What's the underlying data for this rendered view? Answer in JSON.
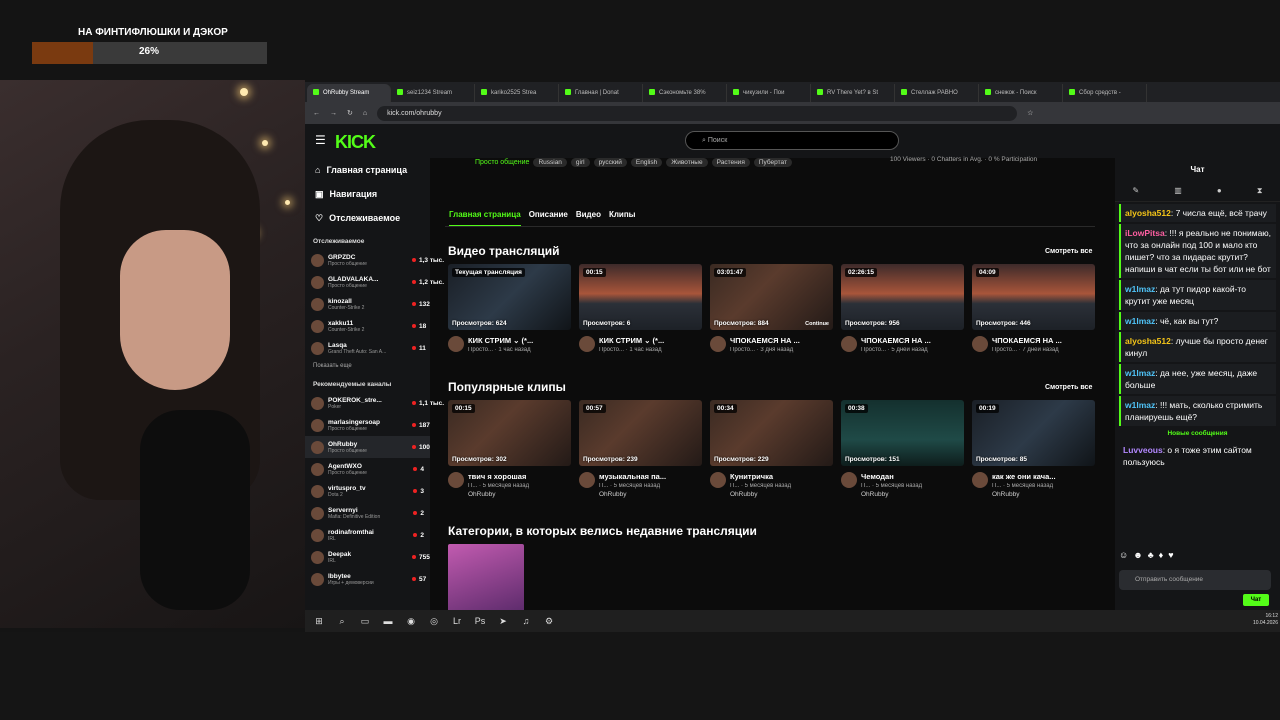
{
  "goal": {
    "title": "НА ФИНТИФЛЮШКИ И ДЭКОР",
    "percent": "26%",
    "progress": 0.26
  },
  "browser": {
    "tabs": [
      "OhRubby Stream",
      "seiz1234 Stream",
      "kariko2525 Strea",
      "Главная | Donat",
      "Сэкономьте 38%",
      "чикузили - Пои",
      "RV There Yet? в St",
      "Стеллаж РАВНО",
      "снежок - Поиск",
      "Сбор средств - "
    ],
    "url": "kick.com/ohrubby"
  },
  "kick": {
    "logo": "KICK",
    "search_placeholder": "Поиск",
    "nav": [
      "Главная страница",
      "Навигация",
      "Отслеживаемое"
    ],
    "following_title": "Отслеживаемое",
    "following": [
      {
        "name": "GRPZDC",
        "sub": "Просто общение",
        "viewers": "1,3 тыс."
      },
      {
        "name": "GLADVALAKA...",
        "sub": "Просто общение",
        "viewers": "1,2 тыс."
      },
      {
        "name": "kinozall",
        "sub": "Counter-Strike 2",
        "viewers": "132"
      },
      {
        "name": "xakku11",
        "sub": "Counter-Strike 2",
        "viewers": "18"
      },
      {
        "name": "Lasqa",
        "sub": "Grand Theft Auto: San A...",
        "viewers": "11"
      }
    ],
    "show_more": "Показать еще",
    "recommended_title": "Рекомендуемые каналы",
    "recommended": [
      {
        "name": "POKEROK_stre...",
        "sub": "Poker",
        "viewers": "1,1 тыс."
      },
      {
        "name": "marlasingersoap",
        "sub": "Просто общение",
        "viewers": "187"
      },
      {
        "name": "OhRubby",
        "sub": "Просто общение",
        "viewers": "100"
      },
      {
        "name": "AgentWXO",
        "sub": "Просто общение",
        "viewers": "4"
      },
      {
        "name": "virtuspro_tv",
        "sub": "Dota 2",
        "viewers": "3"
      },
      {
        "name": "Servernyi",
        "sub": "Mafia: Definitive Edition",
        "viewers": "2"
      },
      {
        "name": "rodinafromthai",
        "sub": "IRL",
        "viewers": "2"
      },
      {
        "name": "Deepak",
        "sub": "IRL",
        "viewers": "755"
      },
      {
        "name": "lbbytee",
        "sub": "Игры + демоверсии",
        "viewers": "57"
      }
    ],
    "category": "Просто общение",
    "tags": [
      "Russian",
      "girl",
      "русский",
      "English",
      "Животные",
      "Растения",
      "Пубертат"
    ],
    "stats": "100 Viewers · 0 Chatters in Avg. · 0 % Participation",
    "page_tabs": [
      "Главная страница",
      "Описание",
      "Видео",
      "Клипы"
    ],
    "videos_title": "Видео трансляций",
    "see_all": "Смотреть все",
    "videos": [
      {
        "label": "Текущая трансляция",
        "views": "Просмотров: 624",
        "title": "КИК СТРИМ ⌄ (*...",
        "sub": "Просто... · 1 час назад",
        "style": "screen",
        "cont": ""
      },
      {
        "label": "00:15",
        "views": "Просмотров: 6",
        "title": "КИК СТРИМ ⌄ (*...",
        "sub": "Просто... · 1 час назад",
        "style": "sunset",
        "cont": ""
      },
      {
        "label": "03:01:47",
        "views": "Просмотров: 884",
        "title": "ЧПОКАЕМСЯ НА ...",
        "sub": "Просто... · 3 дня назад",
        "style": "room",
        "cont": "Continue"
      },
      {
        "label": "02:26:15",
        "views": "Просмотров: 956",
        "title": "ЧПОКАЕМСЯ НА ...",
        "sub": "Просто... · 5 дней назад",
        "style": "sunset",
        "cont": ""
      },
      {
        "label": "04:09",
        "views": "Просмотров: 446",
        "title": "ЧПОКАЕМСЯ НА ...",
        "sub": "Просто... · 7 дней назад",
        "style": "sunset",
        "cont": ""
      }
    ],
    "clips_title": "Популярные клипы",
    "clips": [
      {
        "label": "00:15",
        "views": "Просмотров: 302",
        "title": "твич я хорошая",
        "sub": "П... · 5 месяцев назад",
        "by": "OhRubby",
        "style": "room"
      },
      {
        "label": "00:57",
        "views": "Просмотров: 239",
        "title": "музыкальная па...",
        "sub": "П... · 5 месяцев назад",
        "by": "OhRubby",
        "style": "room"
      },
      {
        "label": "00:34",
        "views": "Просмотров: 229",
        "title": "Кунитричка",
        "sub": "П... · 5 месяцев назад",
        "by": "OhRubby",
        "style": "room"
      },
      {
        "label": "00:38",
        "views": "Просмотров: 151",
        "title": "Чемодан",
        "sub": "П... · 5 месяцев назад",
        "by": "OhRubby",
        "style": "teal"
      },
      {
        "label": "00:19",
        "views": "Просмотров: 85",
        "title": "как же они кача...",
        "sub": "П... · 5 месяцев назад",
        "by": "OhRubby",
        "style": "screen"
      }
    ],
    "categories_title": "Категории, в которых велись недавние трансляции"
  },
  "chat": {
    "title": "Чат",
    "messages": [
      {
        "user": "alyosha512",
        "text": ": 7 числа ещё, всё трачу",
        "color": "#f5c518",
        "hl": true
      },
      {
        "user": "iLowPitsa",
        "text": ": !!! я реально не понимаю, что за онлайн под 100 и мало кто пишет? что за пидарас крутит? напиши в чат если ты бот или не бот",
        "color": "#ff5fa2",
        "hl": true
      },
      {
        "user": "w1lmaz",
        "text": ": да тут пидор какой-то крутит уже месяц",
        "color": "#4fc3f7",
        "hl": true
      },
      {
        "user": "w1lmaz",
        "text": ": чё, как вы тут?",
        "color": "#4fc3f7",
        "hl": true
      },
      {
        "user": "alyosha512",
        "text": ": лучше бы просто денег кинул",
        "color": "#f5c518",
        "hl": true
      },
      {
        "user": "w1lmaz",
        "text": ": да нее, уже месяц, даже больше",
        "color": "#4fc3f7",
        "hl": true
      },
      {
        "user": "w1lmaz",
        "text": ": !!! мать, сколько стримить планируешь ещё?",
        "color": "#4fc3f7",
        "hl": true
      }
    ],
    "new_messages": "Новые сообщения",
    "last": {
      "user": "Luvveous",
      "text": ": о я тоже этим сайтом пользуюсь",
      "color": "#b388ff"
    },
    "input_placeholder": "Отправить сообщение",
    "send": "Чат"
  },
  "clock": {
    "time": "16:12",
    "date": "10.04.2026"
  }
}
